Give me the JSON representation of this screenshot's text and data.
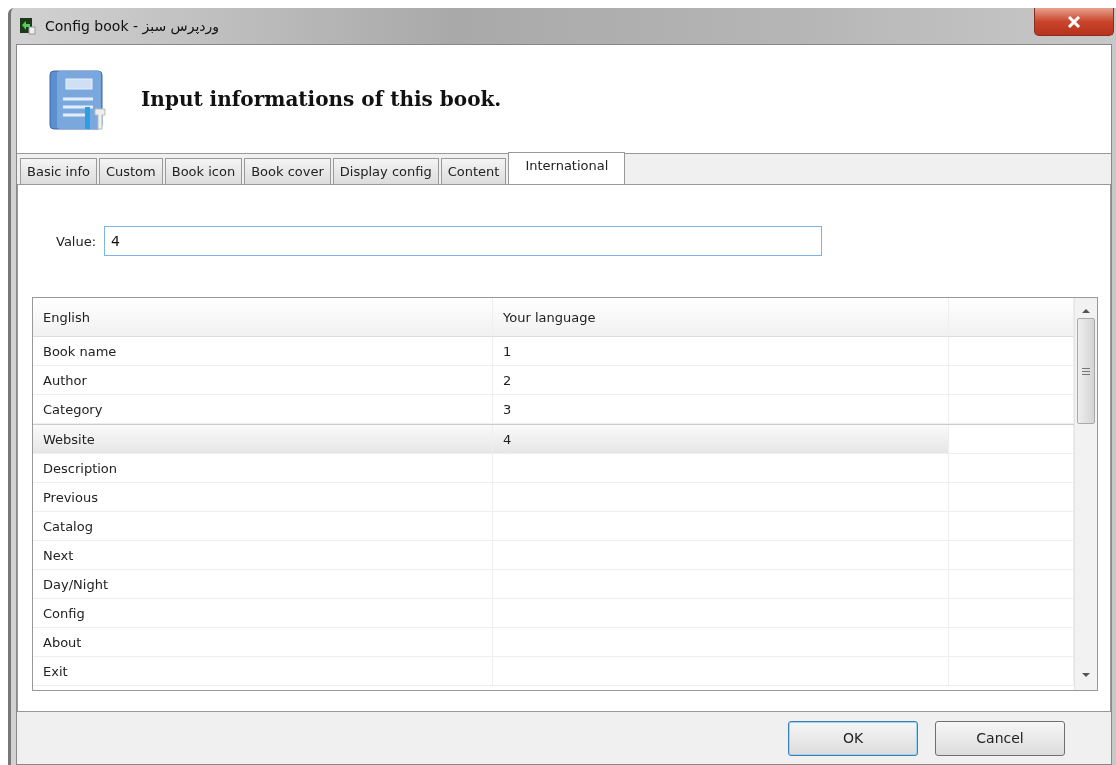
{
  "window": {
    "title": "Config book - وردپرس سبز"
  },
  "header": {
    "title": "Input informations of this book."
  },
  "tabs": [
    {
      "label": "Basic info",
      "selected": false
    },
    {
      "label": "Custom",
      "selected": false
    },
    {
      "label": "Book icon",
      "selected": false
    },
    {
      "label": "Book cover",
      "selected": false
    },
    {
      "label": "Display config",
      "selected": false
    },
    {
      "label": "Content",
      "selected": false
    },
    {
      "label": "International",
      "selected": true
    }
  ],
  "value_field": {
    "label": "Value:",
    "value": "4"
  },
  "table": {
    "columns": [
      "English",
      "Your language"
    ],
    "rows": [
      {
        "english": "Book name",
        "translation": "1",
        "selected": false
      },
      {
        "english": "Author",
        "translation": "2",
        "selected": false
      },
      {
        "english": "Category",
        "translation": "3",
        "selected": false
      },
      {
        "english": "Website",
        "translation": "4",
        "selected": true
      },
      {
        "english": "Description",
        "translation": "",
        "selected": false
      },
      {
        "english": "Previous",
        "translation": "",
        "selected": false
      },
      {
        "english": "Catalog",
        "translation": "",
        "selected": false
      },
      {
        "english": "Next",
        "translation": "",
        "selected": false
      },
      {
        "english": "Day/Night",
        "translation": "",
        "selected": false
      },
      {
        "english": "Config",
        "translation": "",
        "selected": false
      },
      {
        "english": "About",
        "translation": "",
        "selected": false
      },
      {
        "english": "Exit",
        "translation": "",
        "selected": false
      }
    ]
  },
  "buttons": [
    {
      "label": "OK",
      "kind": "default"
    },
    {
      "label": "Cancel",
      "kind": "normal"
    }
  ]
}
